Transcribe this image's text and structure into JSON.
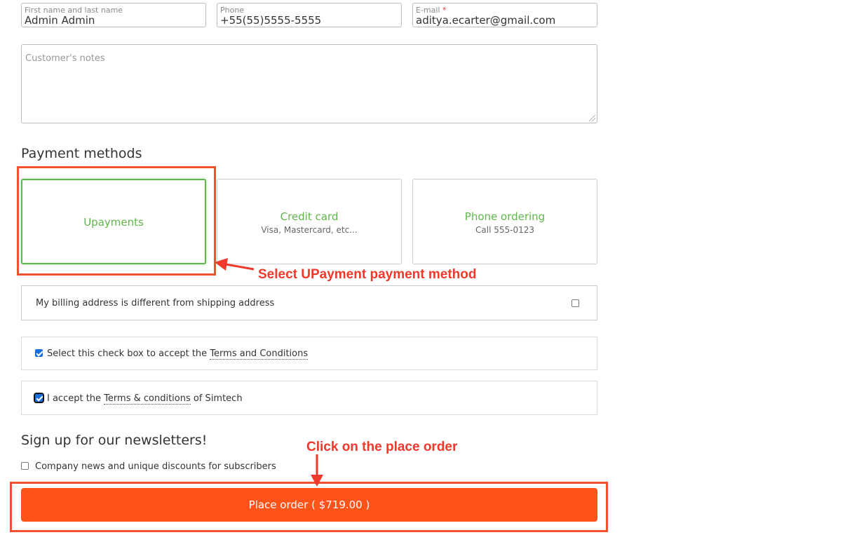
{
  "contact": {
    "name": {
      "label": "First name and last name",
      "value": "Admin Admin"
    },
    "phone": {
      "label": "Phone",
      "value": "+55(55)5555-5555"
    },
    "email": {
      "label": "E-mail",
      "required_mark": "*",
      "value": "aditya.ecarter@gmail.com"
    },
    "notes_placeholder": "Customer's notes"
  },
  "payment": {
    "heading": "Payment methods",
    "methods": [
      {
        "title": "Upayments",
        "subtitle": "",
        "selected": true
      },
      {
        "title": "Credit card",
        "subtitle": "Visa, Mastercard, etc...",
        "selected": false
      },
      {
        "title": "Phone ordering",
        "subtitle": "Call 555-0123",
        "selected": false
      }
    ]
  },
  "billing": {
    "label": "My billing address is different from shipping address",
    "checked": false
  },
  "terms": {
    "prefix": "Select this check box to accept the ",
    "link": "Terms and Conditions",
    "checked": true
  },
  "terms2": {
    "prefix": "I accept the ",
    "link": "Terms & conditions",
    "suffix": " of Simtech",
    "checked": true
  },
  "newsletter": {
    "heading": "Sign up for our newsletters!",
    "option": "Company news and unique discounts for subscribers",
    "checked": false
  },
  "order_button": "Place order ( $719.00 )",
  "annotations": {
    "select_payment": "Select UPayment payment method",
    "click_place_order": "Click on the place order"
  },
  "colors": {
    "accent_green": "#5fb548",
    "order_orange": "#ff5319",
    "annotation_red": "#f0392b"
  }
}
